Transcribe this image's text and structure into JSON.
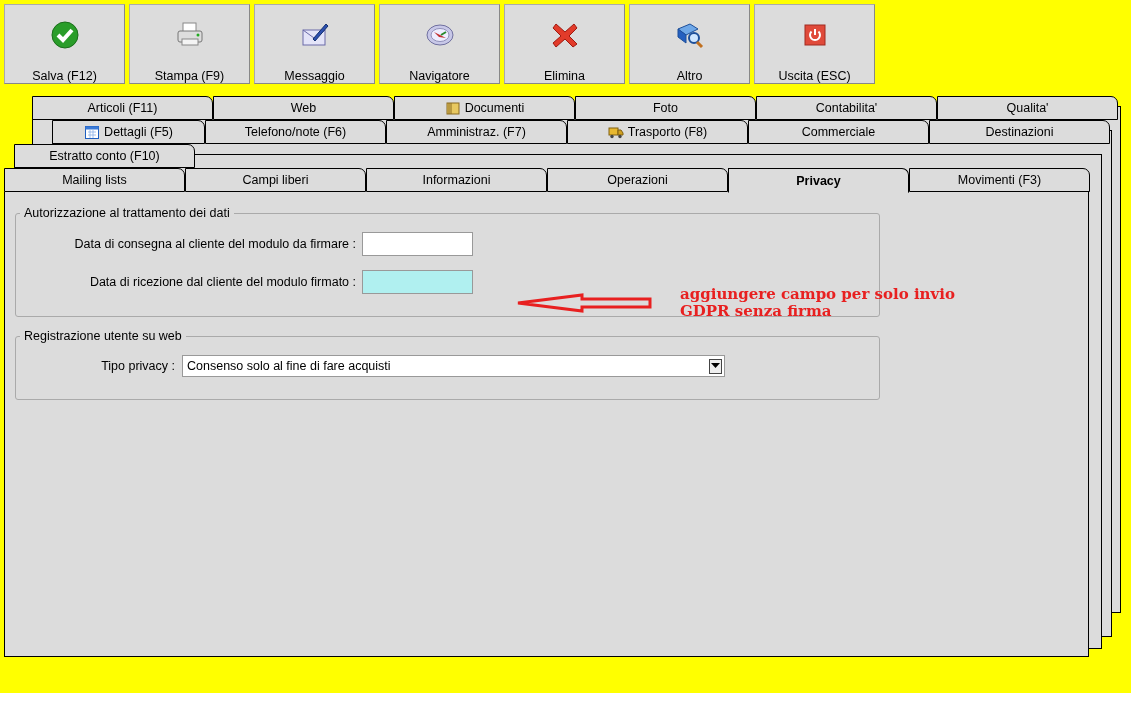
{
  "toolbar": [
    {
      "label": "Salva (F12)"
    },
    {
      "label": "Stampa (F9)"
    },
    {
      "label": "Messaggio"
    },
    {
      "label": "Navigatore"
    },
    {
      "label": "Elimina"
    },
    {
      "label": "Altro"
    },
    {
      "label": "Uscita (ESC)"
    }
  ],
  "tab_rows": [
    [
      {
        "label": "Articoli (F11)",
        "selected": false
      },
      {
        "label": "Web",
        "selected": false
      },
      {
        "label": "Documenti",
        "selected": false
      },
      {
        "label": "Foto",
        "selected": false
      },
      {
        "label": "Contabilita'",
        "selected": false
      },
      {
        "label": "Qualita'",
        "selected": false
      }
    ],
    [
      {
        "label": "Dettagli (F5)",
        "selected": false
      },
      {
        "label": "Telefono/note (F6)",
        "selected": false
      },
      {
        "label": "Amministraz. (F7)",
        "selected": false
      },
      {
        "label": "Trasporto (F8)",
        "selected": false
      },
      {
        "label": "Commerciale",
        "selected": false
      },
      {
        "label": "Destinazioni",
        "selected": false
      }
    ],
    [
      {
        "label": "Estratto conto (F10)",
        "selected": false
      }
    ],
    [
      {
        "label": "Mailing lists",
        "selected": false
      },
      {
        "label": "Campi liberi",
        "selected": false
      },
      {
        "label": "Informazioni",
        "selected": false
      },
      {
        "label": "Operazioni",
        "selected": false
      },
      {
        "label": "Privacy",
        "selected": true
      },
      {
        "label": "Movimenti (F3)",
        "selected": false
      }
    ]
  ],
  "groups": [
    {
      "title": "Autorizzazione al trattamento dei dati",
      "fields": [
        {
          "kind": "date",
          "label": "Data di consegna al cliente del modulo da firmare :",
          "highlighted": false
        },
        {
          "kind": "date",
          "label": "Data di ricezione dal cliente del modulo firmato :",
          "highlighted": true
        }
      ]
    },
    {
      "title": "Registrazione utente su web",
      "fields": [
        {
          "kind": "select",
          "label": "Tipo privacy :",
          "value": "Consenso solo al fine di fare acquisti"
        }
      ]
    }
  ],
  "annotation": {
    "lines": [
      "aggiungere campo per solo invio",
      "GDPR senza firma"
    ]
  }
}
